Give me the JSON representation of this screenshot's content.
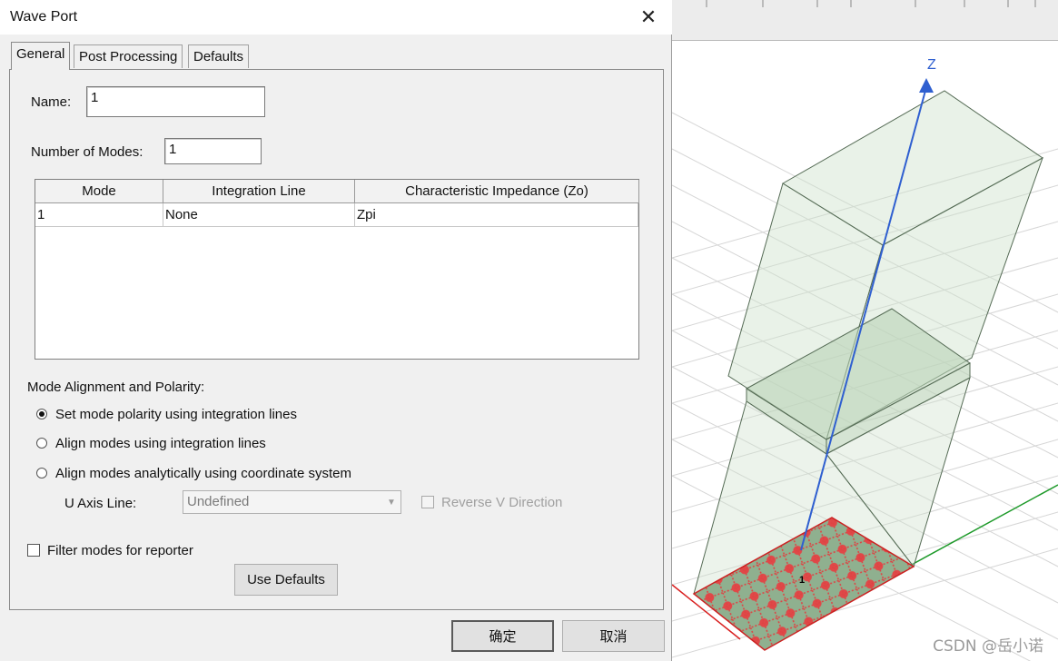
{
  "dialog": {
    "title": "Wave Port",
    "close_glyph": "✕",
    "tabs": [
      {
        "label": "General",
        "active": true
      },
      {
        "label": "Post Processing",
        "active": false
      },
      {
        "label": "Defaults",
        "active": false
      }
    ],
    "name_label": "Name:",
    "name_value": "1",
    "modes_label": "Number of Modes:",
    "modes_value": "1",
    "table": {
      "headers": [
        "Mode",
        "Integration Line",
        "Characteristic Impedance (Zo)"
      ],
      "rows": [
        [
          "1",
          "None",
          "Zpi"
        ]
      ]
    },
    "alignment_heading": "Mode Alignment and Polarity:",
    "radio_options": [
      {
        "label": "Set mode polarity using integration lines",
        "selected": true
      },
      {
        "label": "Align modes using integration lines",
        "selected": false
      },
      {
        "label": "Align modes analytically using coordinate system",
        "selected": false
      }
    ],
    "u_axis_label": "U Axis Line:",
    "u_axis_value": "Undefined",
    "reverse_v_label": "Reverse V Direction",
    "filter_label": "Filter modes for reporter",
    "use_defaults_label": "Use Defaults",
    "ok_label": "确定",
    "cancel_label": "取消"
  },
  "viewport": {
    "axis_label": "Z",
    "port_label": "1",
    "watermark": "CSDN @岳小诺",
    "colors": {
      "z_axis": "#2f5fd0",
      "y_axis": "#1e9a2a",
      "x_axis": "#d92020",
      "port_base": "#8fb08f",
      "port_pattern": "#e04848",
      "box_fill": "#cfe2cc",
      "grid": "#d6d6d6"
    }
  }
}
